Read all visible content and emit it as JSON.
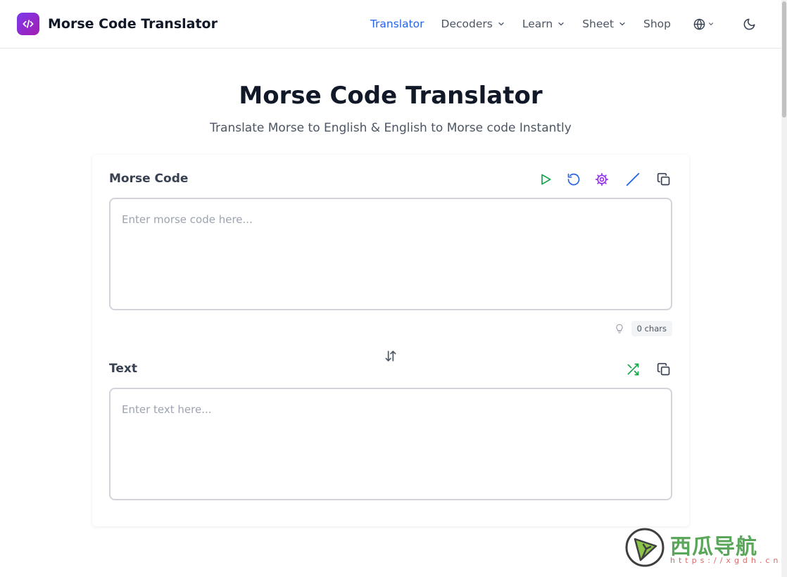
{
  "header": {
    "brand_title": "Morse Code Translator",
    "nav": [
      {
        "label": "Translator",
        "active": true,
        "has_dropdown": false
      },
      {
        "label": "Decoders",
        "active": false,
        "has_dropdown": true
      },
      {
        "label": "Learn",
        "active": false,
        "has_dropdown": true
      },
      {
        "label": "Sheet",
        "active": false,
        "has_dropdown": true
      },
      {
        "label": "Shop",
        "active": false,
        "has_dropdown": false
      }
    ],
    "icons": [
      "code-logo-icon",
      "globe-icon",
      "moon-icon"
    ]
  },
  "hero": {
    "title": "Morse Code Translator",
    "subtitle": "Translate Morse to English & English to Morse code Instantly"
  },
  "morse_section": {
    "label": "Morse Code",
    "placeholder": "Enter morse code here...",
    "value": "",
    "char_count": "0 chars",
    "tools": [
      "play-icon",
      "reset-icon",
      "settings-icon",
      "slash-icon",
      "copy-icon"
    ]
  },
  "text_section": {
    "label": "Text",
    "placeholder": "Enter text here...",
    "value": "",
    "tools": [
      "shuffle-icon",
      "copy-icon"
    ]
  },
  "watermark": {
    "text": "西瓜导航",
    "url": "https://xgdh.cn"
  },
  "colors": {
    "brand": "#7c3aed",
    "active_nav": "#2563eb",
    "play": "#16a34a",
    "reset": "#2563eb",
    "settings": "#9333ea",
    "slash": "#2563eb",
    "shuffle": "#16a34a"
  }
}
